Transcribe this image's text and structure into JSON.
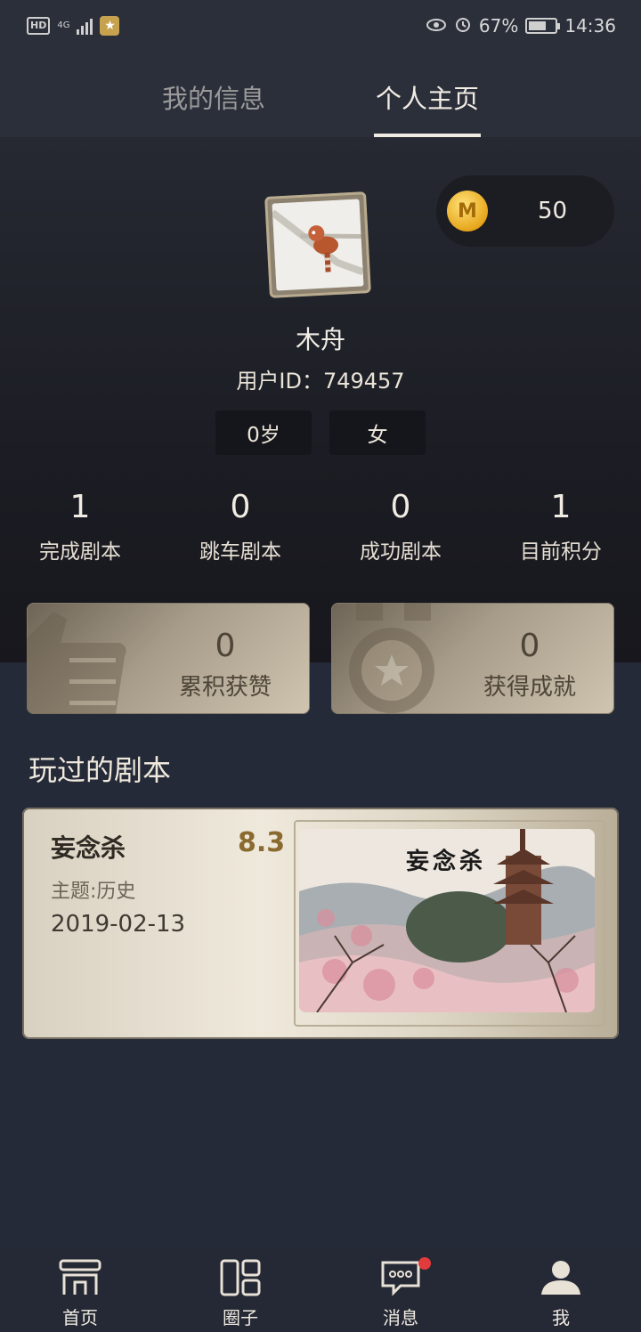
{
  "status_bar": {
    "hd": "HD",
    "net": "4G",
    "battery": "67%",
    "battery_level": 0.67,
    "time": "14:36"
  },
  "tabs": [
    {
      "label": "我的信息",
      "active": false
    },
    {
      "label": "个人主页",
      "active": true
    }
  ],
  "profile": {
    "coins": "50",
    "nickname": "木舟",
    "user_id": "用户ID：749457",
    "age": "0岁",
    "gender": "女"
  },
  "stats": [
    {
      "value": "1",
      "label": "完成剧本"
    },
    {
      "value": "0",
      "label": "跳车剧本"
    },
    {
      "value": "0",
      "label": "成功剧本"
    },
    {
      "value": "1",
      "label": "目前积分"
    }
  ],
  "achievements": {
    "likes": {
      "value": "0",
      "label": "累积获赞"
    },
    "badges": {
      "value": "0",
      "label": "获得成就"
    }
  },
  "played": {
    "title": "玩过的剧本",
    "items": [
      {
        "name": "妄念杀",
        "score": "8.3",
        "theme": "主题:历史",
        "date": "2019-02-13",
        "cover_title": "妄念杀"
      }
    ]
  },
  "bottom_nav": [
    {
      "label": "首页",
      "icon": "home-icon"
    },
    {
      "label": "圈子",
      "icon": "circle-icon"
    },
    {
      "label": "消息",
      "icon": "message-icon",
      "badge": true
    },
    {
      "label": "我",
      "icon": "profile-icon"
    }
  ],
  "colors": {
    "background": "#252a38",
    "accent_text": "#f0ebe2",
    "score": "#8a6a2e",
    "badge": "#e23b3b"
  }
}
